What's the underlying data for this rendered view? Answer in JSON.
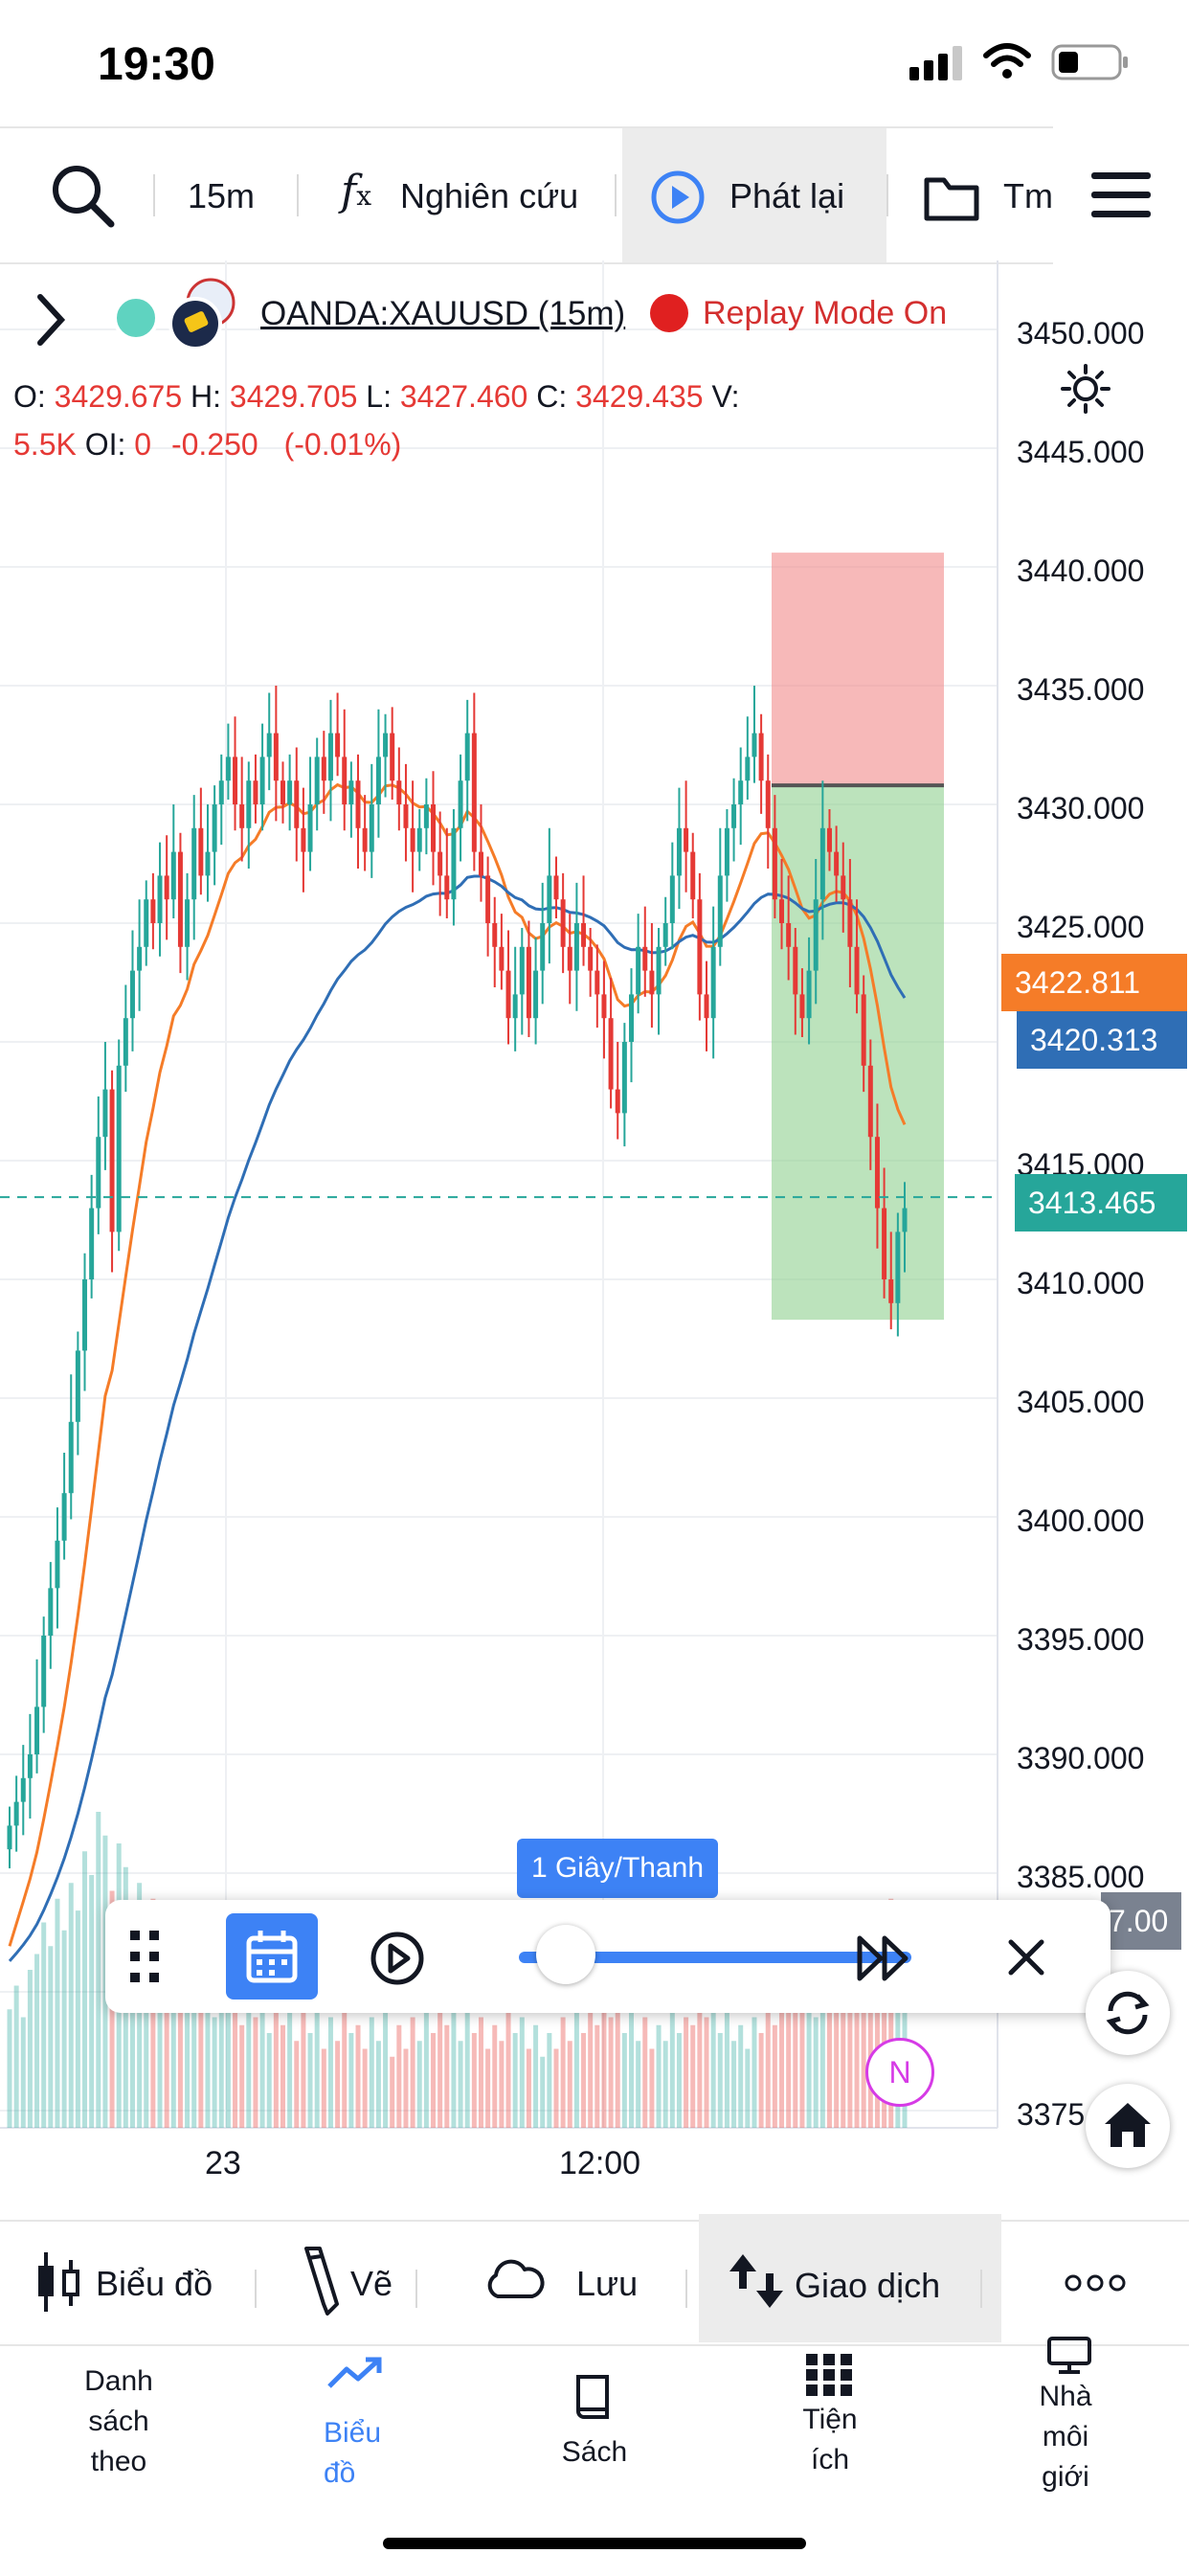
{
  "status_bar": {
    "time": "19:30"
  },
  "toolbar": {
    "interval": "15m",
    "indicators_label": "Nghiên cứu",
    "replay_label": "Phát lại",
    "templates_label": "Tm"
  },
  "symbol": {
    "name": "OANDA:XAUUSD (15m)",
    "replay_mode": "Replay Mode On"
  },
  "ohlc": {
    "o_label": "O:",
    "o_value": "3429.675",
    "h_label": "H:",
    "h_value": "3429.705",
    "l_label": "L:",
    "l_value": "3427.460",
    "c_label": "C:",
    "c_value": "3429.435",
    "v_label": "V:",
    "v_value": "5.5K",
    "oi_label": "OI:",
    "oi_value": "0",
    "change": "-0.250",
    "change_pct": "(-0.01%)"
  },
  "price_axis": [
    "3450.000",
    "3445.000",
    "3440.000",
    "3435.000",
    "3430.000",
    "3425.000",
    "3415.000",
    "3410.000",
    "3405.000",
    "3400.000",
    "3395.000",
    "3390.000",
    "3385.000",
    "3375"
  ],
  "price_badges": {
    "ema_fast": "3422.811",
    "ema_slow": "3420.313",
    "last": "3413.465",
    "hidden": "7.00"
  },
  "time_axis": [
    "23",
    "12:00"
  ],
  "replay": {
    "speed": "1 Giây/Thanh"
  },
  "badge_n": "N",
  "bottom_tools": {
    "chart_label": "Biểu đồ",
    "draw_label": "Vẽ",
    "save_label": "Lưu",
    "trade_label": "Giao dịch"
  },
  "nav": {
    "watchlist": [
      "Danh",
      "sách",
      "theo"
    ],
    "chart": [
      "Biểu",
      "đồ"
    ],
    "book": "Sách",
    "utilities": [
      "Tiện",
      "ích"
    ],
    "brokers": [
      "Nhà",
      "môi",
      "giới"
    ]
  },
  "colors": {
    "up": "#26a69a",
    "down": "#e53935",
    "ema_fast": "#f57c28",
    "ema_slow": "#2f6eb5",
    "accent": "#3d82f5"
  },
  "chart_data": {
    "type": "candlestick",
    "title": "OANDA:XAUUSD (15m)",
    "ylim": [
      3373,
      3452
    ],
    "x_ticks": [
      "23",
      "12:00"
    ],
    "current_price": 3413.465,
    "ema_fast_last": 3422.811,
    "ema_slow_last": 3420.313,
    "position": {
      "entry": 3430.8,
      "stop": 3440.6,
      "target": 3408.3
    },
    "closes": [
      3387,
      3388,
      3389,
      3390,
      3392,
      3395,
      3397,
      3399,
      3401,
      3404,
      3407,
      3410,
      3413,
      3416,
      3418,
      3412,
      3419,
      3421,
      3423,
      3424,
      3426,
      3425,
      3427,
      3426,
      3428,
      3424,
      3426,
      3429,
      3427,
      3428,
      3430,
      3431,
      3432,
      3430,
      3429,
      3431,
      3430,
      3432,
      3433,
      3431,
      3430,
      3431,
      3429,
      3428,
      3430,
      3432,
      3431,
      3433,
      3432,
      3430,
      3431,
      3429,
      3428,
      3430,
      3432,
      3433,
      3431,
      3430,
      3429,
      3428,
      3429,
      3430,
      3428,
      3427,
      3426,
      3429,
      3431,
      3433,
      3428,
      3427,
      3425,
      3424,
      3423,
      3421,
      3422,
      3424,
      3421,
      3423,
      3425,
      3427,
      3426,
      3424,
      3423,
      3425,
      3424,
      3423,
      3422,
      3421,
      3418,
      3417,
      3420,
      3422,
      3424,
      3423,
      3422,
      3424,
      3425,
      3427,
      3429,
      3428,
      3426,
      3422,
      3421,
      3424,
      3427,
      3429,
      3430,
      3431,
      3432,
      3433,
      3431,
      3429,
      3426,
      3425,
      3424,
      3422,
      3421,
      3423,
      3426,
      3429,
      3428,
      3427,
      3426,
      3424,
      3422,
      3419,
      3416,
      3413,
      3410,
      3409,
      3412,
      3413
    ],
    "volumes": [
      30,
      36,
      28,
      40,
      44,
      52,
      46,
      58,
      50,
      62,
      55,
      70,
      64,
      80,
      74,
      60,
      72,
      66,
      56,
      62,
      50,
      58,
      44,
      52,
      40,
      48,
      36,
      44,
      32,
      40,
      28,
      36,
      30,
      38,
      26,
      34,
      28,
      36,
      24,
      32,
      26,
      34,
      22,
      30,
      24,
      32,
      20,
      28,
      22,
      30,
      24,
      26,
      20,
      28,
      22,
      30,
      18,
      26,
      20,
      28,
      22,
      30,
      24,
      32,
      26,
      34,
      22,
      30,
      24,
      28,
      20,
      26,
      22,
      30,
      24,
      28,
      20,
      26,
      18,
      24,
      20,
      28,
      22,
      30,
      24,
      32,
      26,
      34,
      28,
      36,
      24,
      30,
      22,
      28,
      20,
      26,
      22,
      30,
      24,
      28,
      26,
      32,
      28,
      36,
      24,
      30,
      22,
      26,
      20,
      28,
      24,
      30,
      26,
      34,
      30,
      38,
      32,
      40,
      28,
      34,
      30,
      36,
      32,
      42,
      38,
      46,
      40,
      52,
      48,
      58,
      44,
      50
    ]
  }
}
